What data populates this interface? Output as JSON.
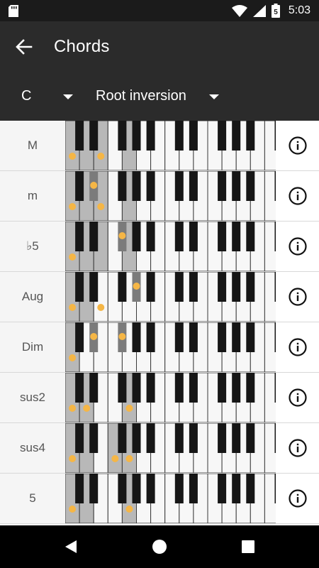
{
  "status_bar": {
    "time": "5:03",
    "battery_level": "5",
    "icons": [
      "sd-card-icon",
      "wifi-icon",
      "signal-icon",
      "battery-icon"
    ]
  },
  "app_bar": {
    "title": "Chords",
    "back_icon": "arrow-left-icon"
  },
  "selectors": {
    "key": "C",
    "inversion": "Root inversion"
  },
  "colors": {
    "app_bar": "#2b2b2b",
    "status_bar": "#1b1b1b",
    "highlight_white": "#b8b8b8",
    "highlight_black": "#7b7b7b",
    "dot": "#f5b646"
  },
  "chords": [
    {
      "name": "M",
      "white_dots": [
        0,
        2
      ],
      "black_dots": [],
      "highlight_white": [
        0,
        1,
        2,
        4
      ],
      "highlight_black": [
        0,
        1,
        2
      ]
    },
    {
      "name": "m",
      "white_dots": [
        0,
        2
      ],
      "black_dots": [
        1
      ],
      "highlight_white": [
        0,
        1,
        2,
        4
      ],
      "highlight_black": [
        0,
        1,
        2
      ]
    },
    {
      "name": "♭5",
      "white_dots": [
        0
      ],
      "black_dots": [
        2
      ],
      "highlight_white": [
        0,
        1,
        2,
        4
      ],
      "highlight_black": [
        0,
        1,
        2
      ]
    },
    {
      "name": "Aug",
      "white_dots": [
        0,
        2
      ],
      "black_dots": [
        3
      ],
      "highlight_white": [
        0,
        1
      ],
      "highlight_black": [
        0,
        1,
        3
      ]
    },
    {
      "name": "Dim",
      "white_dots": [
        0
      ],
      "black_dots": [
        1,
        2
      ],
      "highlight_white": [
        0
      ],
      "highlight_black": [
        0,
        1,
        2
      ]
    },
    {
      "name": "sus2",
      "white_dots": [
        0,
        1,
        4
      ],
      "black_dots": [],
      "highlight_white": [
        0,
        1,
        4
      ],
      "highlight_black": [
        0,
        1
      ]
    },
    {
      "name": "sus4",
      "white_dots": [
        0,
        3,
        4
      ],
      "black_dots": [],
      "highlight_white": [
        0,
        1,
        3,
        4
      ],
      "highlight_black": [
        0,
        1
      ]
    },
    {
      "name": "5",
      "white_dots": [
        0,
        4
      ],
      "black_dots": [],
      "highlight_white": [
        0,
        1,
        4
      ],
      "highlight_black": [
        0,
        1
      ]
    }
  ],
  "info_icon": "info-circle-icon",
  "nav_bar": [
    "nav-back-icon",
    "nav-home-icon",
    "nav-recent-icon"
  ]
}
